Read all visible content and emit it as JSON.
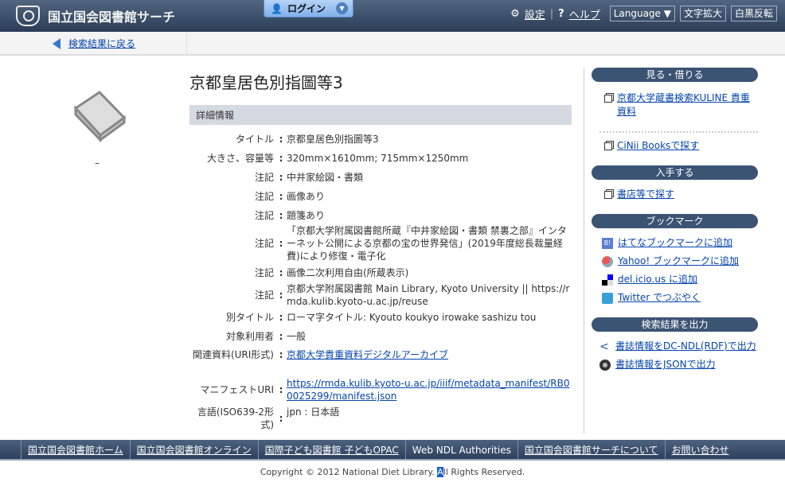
{
  "header": {
    "site_name": "国立国会図書館サーチ",
    "login": "ログイン",
    "settings": "設定",
    "help": "ヘルプ",
    "language": "Language ▼",
    "font_size": "文字拡大",
    "invert": "白黒反転"
  },
  "subbar": {
    "back": "検索結果に戻る"
  },
  "item": {
    "placeholder_dash": "–",
    "title": "京都皇居色別指圖等3",
    "details_header": "詳細情報",
    "rows": [
      {
        "label": "タイトル",
        "value": "京都皇居色別指圖等3"
      },
      {
        "label": "大きさ、容量等",
        "value": "320mm×1610mm; 715mm×1250mm"
      },
      {
        "label": "注記",
        "value": "中井家絵図・書類"
      },
      {
        "label": "注記",
        "value": "画像あり"
      },
      {
        "label": "注記",
        "value": "題箋あり"
      },
      {
        "label": "注記",
        "value": "「京都大学附属図書館所蔵『中井家絵図・書類 禁裏之部』インターネット公開による京都の宝の世界発信」(2019年度総長裁量経費)により修復・電子化"
      },
      {
        "label": "注記",
        "value": "画像二次利用自由(所蔵表示)"
      },
      {
        "label": "注記",
        "value": "京都大学附属図書館 Main Library, Kyoto University || https://rmda.kulib.kyoto-u.ac.jp/reuse"
      },
      {
        "label": "別タイトル",
        "value": "ローマ字タイトル: Kyouto koukyo irowake sashizu tou"
      },
      {
        "label": "対象利用者",
        "value": "一般"
      },
      {
        "label": "関連資料(URI形式)",
        "value": "京都大学貴重資料デジタルアーカイブ",
        "link": true
      },
      {
        "label": "マニフェストURI",
        "value": "https://rmda.kulib.kyoto-u.ac.jp/iiif/metadata_manifest/RB00025299/manifest.json",
        "link": true
      },
      {
        "label": "言語(ISO639-2形式)",
        "value": "jpn : 日本語"
      }
    ]
  },
  "sidebar": {
    "view_borrow": {
      "header": "見る・借りる",
      "items": [
        "京都大学蔵書検索KULINE 貴重資料",
        "CiNii Booksで探す"
      ]
    },
    "obtain": {
      "header": "入手する",
      "items": [
        "書店等で探す"
      ]
    },
    "bookmark": {
      "header": "ブックマーク",
      "items": [
        "はてなブックマークに追加",
        "Yahoo! ブックマークに追加",
        "del.icio.us に追加",
        "Twitter でつぶやく"
      ]
    },
    "export": {
      "header": "検索結果を出力",
      "items": [
        "書誌情報をDC-NDL(RDF)で出力",
        "書誌情報をJSONで出力"
      ]
    }
  },
  "footer": {
    "links": [
      "国立国会図書館ホーム",
      "国立国会図書館オンライン",
      "国際子ども図書館 子どもOPAC",
      "Web NDL Authorities",
      "国立国会図書館サーチについて",
      "お問い合わせ"
    ],
    "copyright_pre": "Copyright © 2012 National Diet Library. ",
    "copyright_sel": "A",
    "copyright_post": "ll Rights Reserved."
  }
}
